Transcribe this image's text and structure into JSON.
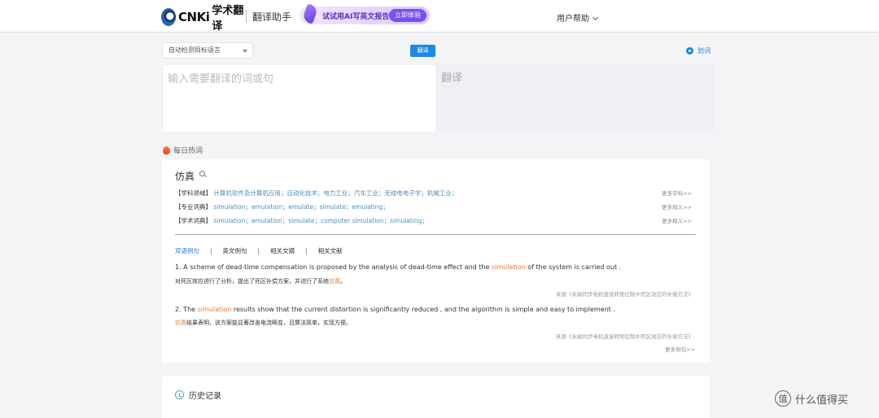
{
  "header": {
    "logo_text": "CNKi",
    "logo_cn": "学术翻译",
    "assistant": "翻译助手",
    "banner_text": "试试用AI写英文报告",
    "banner_button": "立即体验",
    "help": "用户帮助"
  },
  "toolbar": {
    "lang_select": "自动检测目标语言",
    "translate_button": "翻译",
    "word_mark": "划词"
  },
  "editor": {
    "input_placeholder": "输入需要翻译的词或句",
    "output_placeholder": "翻译"
  },
  "hot": {
    "title": "每日热词",
    "word": "仿真",
    "definitions": [
      {
        "tag": "【学科领域】",
        "value": "计算机软件及计算机应用；自动化技术；电力工业；汽车工业；无线电电子学；机械工业；",
        "more": "更多学科>>"
      },
      {
        "tag": "【专业词典】",
        "value": "simulation；emulation；emulate；simulate；emulating；",
        "more": "更多释义>>"
      },
      {
        "tag": "【学术词典】",
        "value": "simulation；emulation；simulate；computer simulation；simulating；",
        "more": "更多释义>>"
      }
    ],
    "tabs": [
      "双语例句",
      "英文例句",
      "相关文摘",
      "相关文献"
    ],
    "examples": [
      {
        "en_pre": "1. A scheme of dead-time compensation is proposed by the analysis of dead-time effect and the ",
        "en_hl": "simulation",
        "en_post": " of the system is carried out .",
        "cn_pre": "对死区效应进行了分析，提出了死区补偿方案，并进行了系统",
        "cn_hl": "仿真",
        "cn_post": "。",
        "source": "来源《永磁同步电机直接转矩控制中死区效应的补偿方法》"
      },
      {
        "en_pre": "2. The ",
        "en_hl": "simulation",
        "en_post": " results show that the current distortion is significantly reduced , and the algorithm is simple and easy to implement .",
        "cn_pre": "",
        "cn_hl": "仿真",
        "cn_post": "结果表明，该方案能显著改善电流畸变，且算法简单，实现方便。",
        "source": "来源《永磁同步电机直接转矩控制中死区效应的补偿方法》"
      }
    ],
    "more_examples": "更多例句>>"
  },
  "history": {
    "title": "历史记录"
  },
  "watermark": {
    "icon": "值",
    "text": "什么值得买"
  },
  "colors": {
    "accent": "#1e88e5",
    "highlight": "#e07b3c",
    "definition": "#4a8fb8"
  }
}
